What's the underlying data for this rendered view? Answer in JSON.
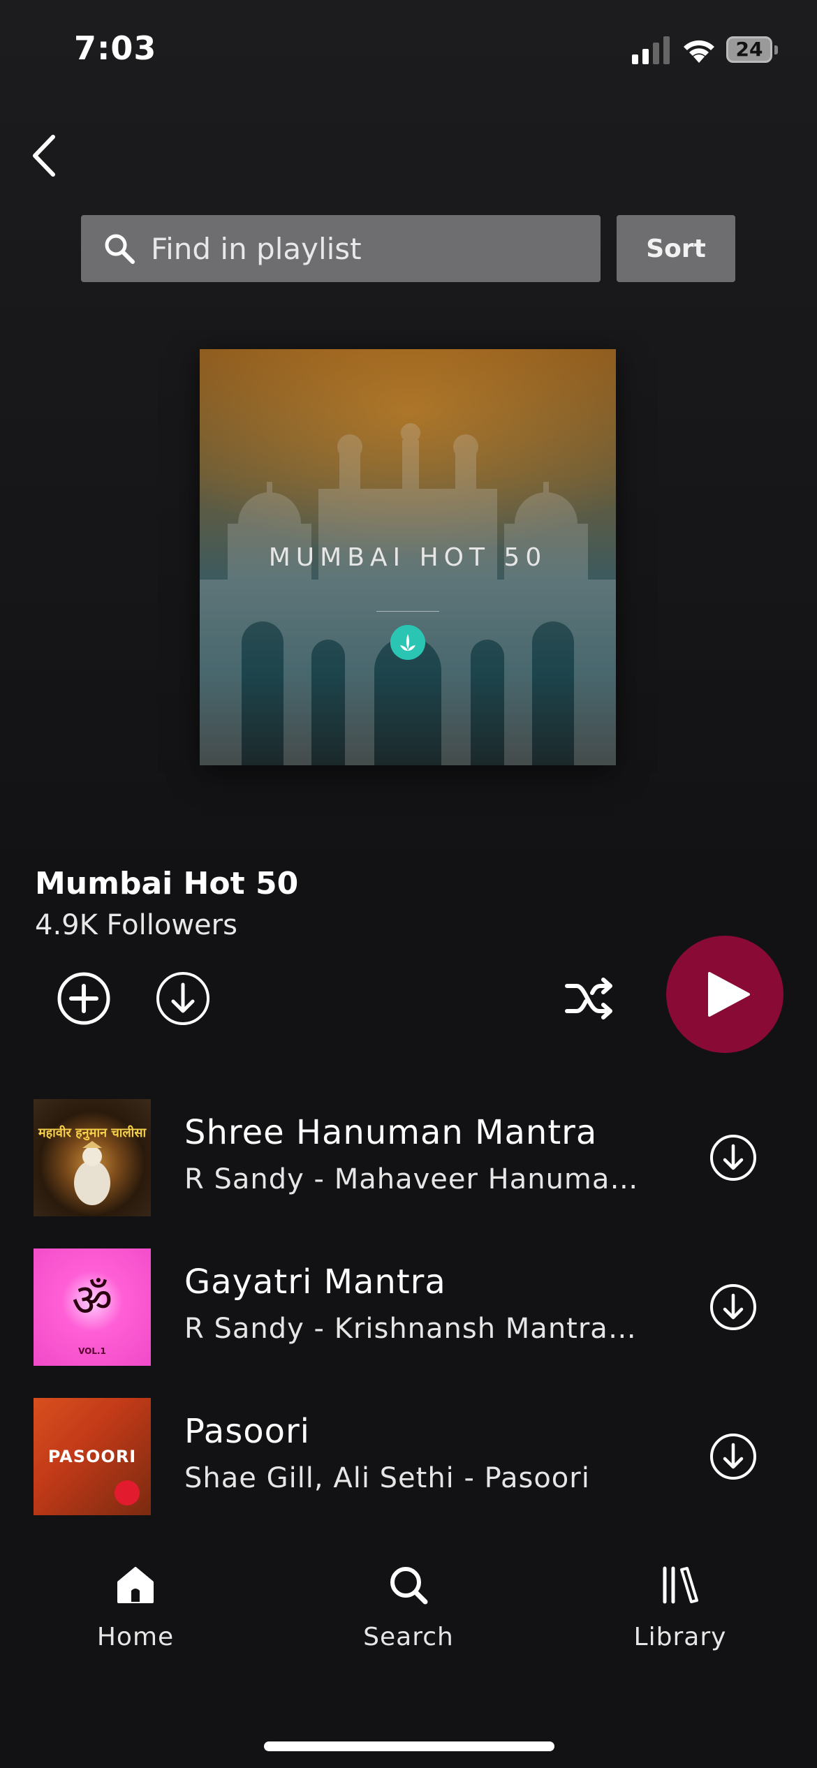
{
  "status_bar": {
    "time": "7:03",
    "battery": "24"
  },
  "search": {
    "placeholder": "Find in playlist",
    "sort_label": "Sort"
  },
  "cover": {
    "title": "MUMBAI HOT 50"
  },
  "playlist": {
    "title": "Mumbai Hot 50",
    "followers": "4.9K Followers"
  },
  "songs": [
    {
      "title": "Shree Hanuman Mantra",
      "subtitle": "R Sandy - Mahaveer Hanuman Chalisa",
      "art_text": "महावीर हनुमान चालीसा"
    },
    {
      "title": "Gayatri Mantra",
      "subtitle": "R Sandy - Krishnansh Mantra Sangrah",
      "art_text": "ॐ",
      "art_sub": "VOL.1"
    },
    {
      "title": "Pasoori",
      "subtitle": "Shae Gill, Ali Sethi - Pasoori",
      "art_text": "PASOORI"
    }
  ],
  "tabs": [
    {
      "label": "Home",
      "icon": "home-icon"
    },
    {
      "label": "Search",
      "icon": "search-icon"
    },
    {
      "label": "Library",
      "icon": "library-icon"
    }
  ],
  "colors": {
    "background": "#121214",
    "accent": "#8a0a36",
    "input_bg": "#6e6e70"
  }
}
